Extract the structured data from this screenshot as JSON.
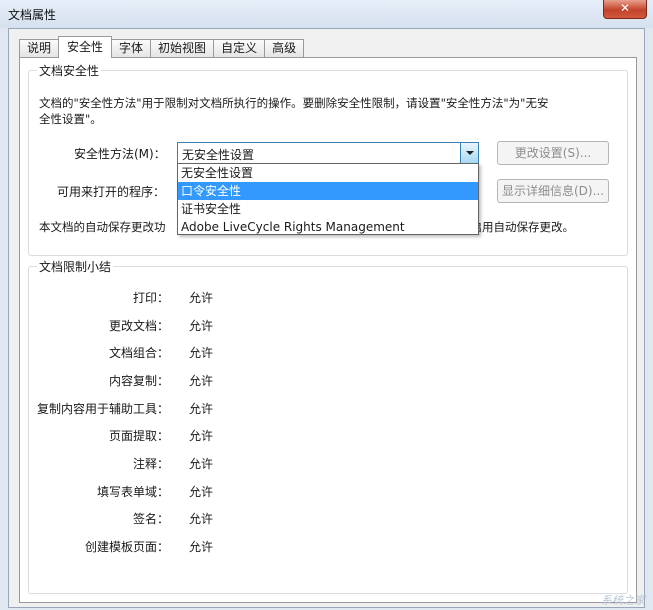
{
  "window": {
    "title": "文档属性",
    "close_glyph": "✕"
  },
  "tabs": [
    {
      "label": "说明",
      "active": false
    },
    {
      "label": "安全性",
      "active": true
    },
    {
      "label": "字体",
      "active": false
    },
    {
      "label": "初始视图",
      "active": false
    },
    {
      "label": "自定义",
      "active": false
    },
    {
      "label": "高级",
      "active": false
    }
  ],
  "security": {
    "group_title": "文档安全性",
    "description": "文档的\"安全性方法\"用于限制对文档所执行的操作。要删除安全性限制，请设置\"安全性方法\"为\"无安全性设置\"。",
    "method_label": "安全性方法(M)：",
    "method_value": "无安全性设置",
    "change_settings_button": "更改设置(S)...",
    "open_with_label": "可用来打开的程序：",
    "show_details_button": "显示详细信息(D)...",
    "autosave_text_start": "本文档的自动保存更改功",
    "autosave_text_end": "重新启用自动保存更改。",
    "dropdown_options": [
      {
        "label": "无安全性设置",
        "selected": false
      },
      {
        "label": "口令安全性",
        "selected": true
      },
      {
        "label": "证书安全性",
        "selected": false
      },
      {
        "label": "Adobe LiveCycle Rights Management",
        "selected": false
      }
    ]
  },
  "restrictions": {
    "group_title": "文档限制小结",
    "rows": [
      {
        "label": "打印：",
        "value": "允许"
      },
      {
        "label": "更改文档：",
        "value": "允许"
      },
      {
        "label": "文档组合：",
        "value": "允许"
      },
      {
        "label": "内容复制：",
        "value": "允许"
      },
      {
        "label": "复制内容用于辅助工具：",
        "value": "允许"
      },
      {
        "label": "页面提取：",
        "value": "允许"
      },
      {
        "label": "注释：",
        "value": "允许"
      },
      {
        "label": "填写表单域：",
        "value": "允许"
      },
      {
        "label": "签名：",
        "value": "允许"
      },
      {
        "label": "创建模板页面：",
        "value": "允许"
      }
    ]
  },
  "watermark": "系统之家"
}
